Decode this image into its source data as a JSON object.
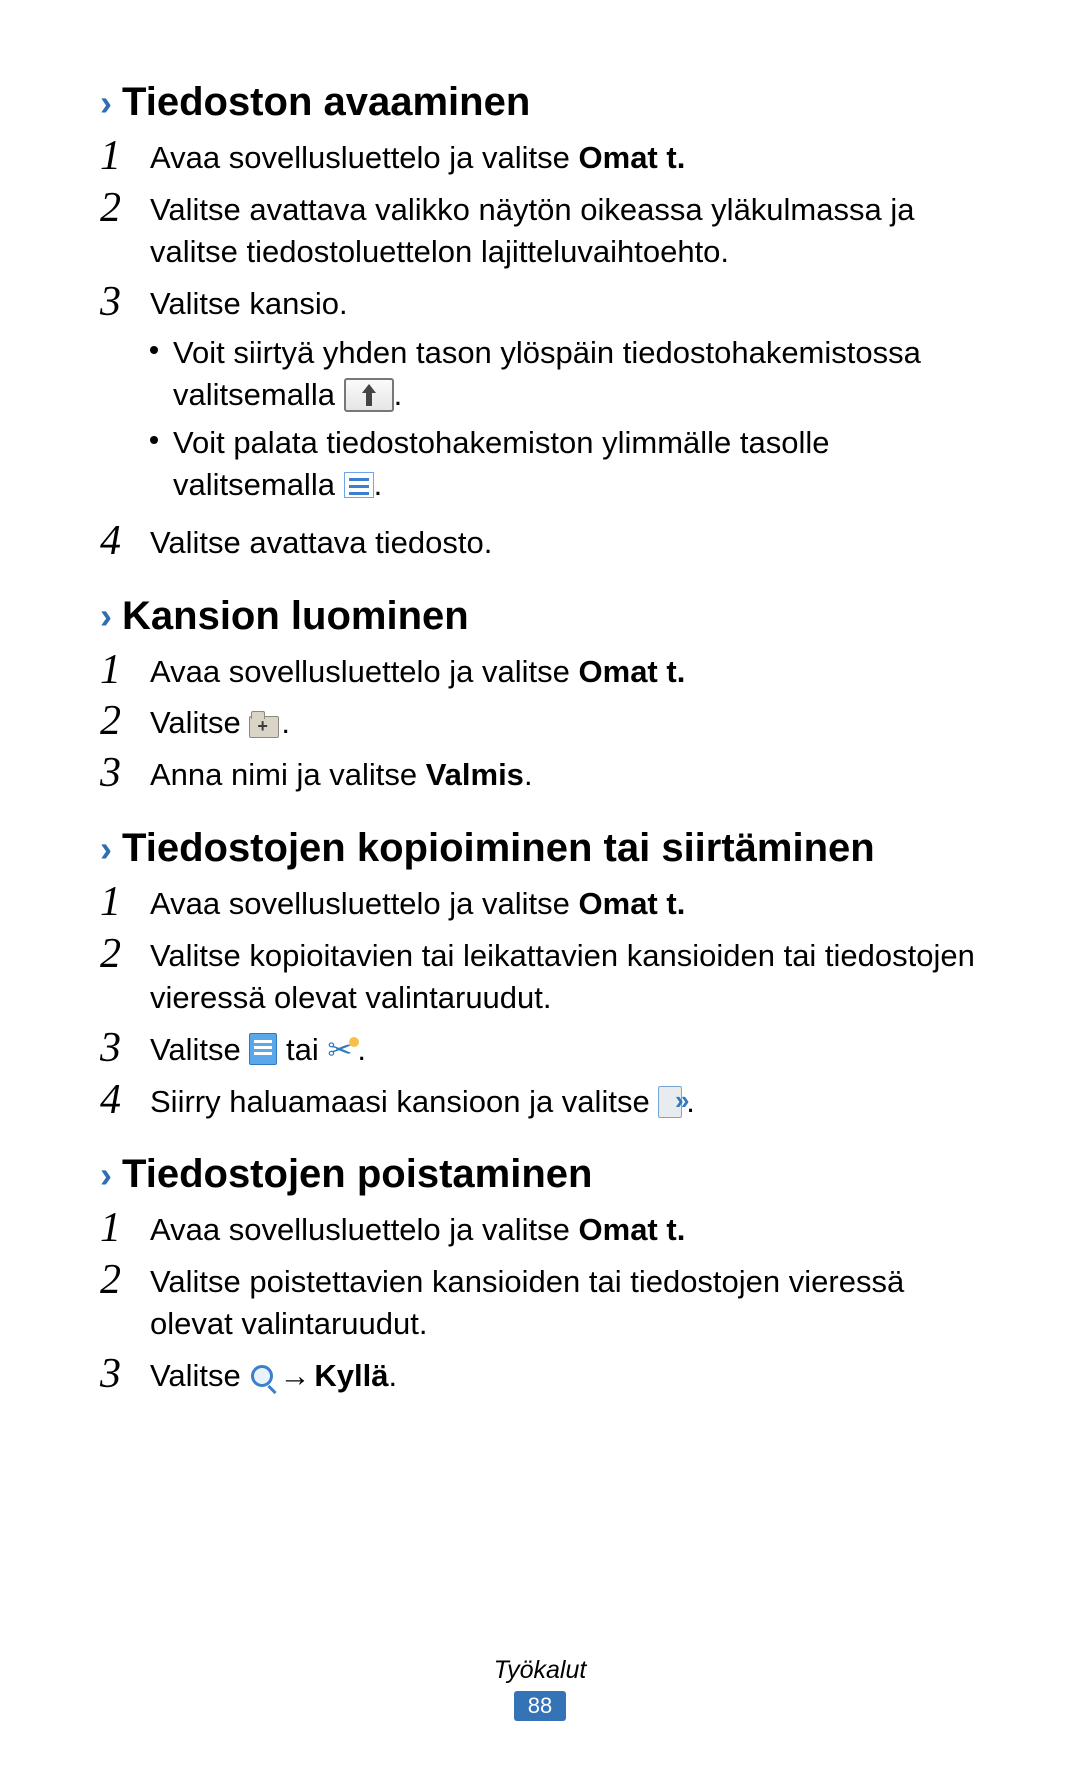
{
  "sections": [
    {
      "heading": "Tiedoston avaaminen",
      "steps": {
        "s1_pre": "Avaa sovellusluettelo ja valitse ",
        "s1_bold": "Omat t.",
        "s2": "Valitse avattava valikko näytön oikeassa yläkulmassa ja valitse tiedostoluettelon lajitteluvaihtoehto.",
        "s3": "Valitse kansio.",
        "s3_b1_pre": "Voit siirtyä yhden tason ylöspäin tiedostohakemistossa valitsemalla ",
        "s3_b1_post": ".",
        "s3_b2_pre": "Voit palata tiedostohakemiston ylimmälle tasolle valitsemalla ",
        "s3_b2_post": ".",
        "s4": "Valitse avattava tiedosto."
      }
    },
    {
      "heading": "Kansion luominen",
      "steps": {
        "s1_pre": "Avaa sovellusluettelo ja valitse ",
        "s1_bold": "Omat t.",
        "s2_pre": "Valitse ",
        "s2_post": ".",
        "s3_pre": "Anna nimi ja valitse ",
        "s3_bold": "Valmis",
        "s3_post": "."
      }
    },
    {
      "heading": "Tiedostojen kopioiminen tai siirtäminen",
      "steps": {
        "s1_pre": "Avaa sovellusluettelo ja valitse ",
        "s1_bold": "Omat t.",
        "s2": "Valitse kopioitavien tai leikattavien kansioiden tai tiedostojen vieressä olevat valintaruudut.",
        "s3_pre": "Valitse ",
        "s3_mid": " tai ",
        "s3_post": ".",
        "s4_pre": "Siirry haluamaasi kansioon ja valitse ",
        "s4_post": "."
      }
    },
    {
      "heading": "Tiedostojen poistaminen",
      "steps": {
        "s1_pre": "Avaa sovellusluettelo ja valitse ",
        "s1_bold": "Omat t.",
        "s2": "Valitse poistettavien kansioiden tai tiedostojen vieressä olevat valintaruudut.",
        "s3_pre": "Valitse ",
        "s3_arrow": " → ",
        "s3_bold": "Kyllä",
        "s3_post": "."
      }
    }
  ],
  "footer": {
    "category": "Työkalut",
    "page": "88"
  }
}
